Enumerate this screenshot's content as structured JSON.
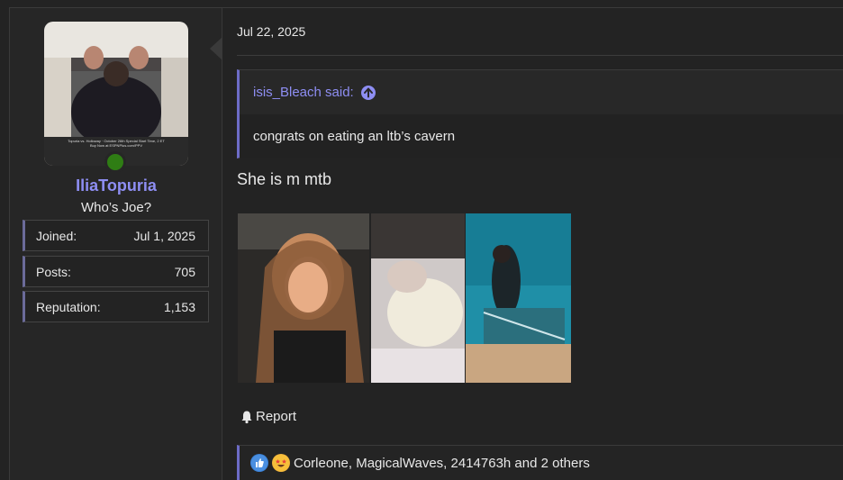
{
  "user": {
    "name": "IliaTopuria",
    "title": "Who’s Joe?",
    "avatar_caption_line1": "Topuria vs. Holloway · October 26th Special Start Time, 2 ET",
    "avatar_caption_line2": "Buy Now at ESPNPlus.com/PPV",
    "stats": [
      {
        "label": "Joined:",
        "value": "Jul 1, 2025"
      },
      {
        "label": "Posts:",
        "value": "705"
      },
      {
        "label": "Reputation:",
        "value": "1,153"
      }
    ],
    "online_color": "#2f7d14"
  },
  "post": {
    "date": "Jul 22, 2025",
    "quote_author": "isis_Bleach said:",
    "quote_text": "congrats on eating an ltb’s cavern",
    "message": "She is m mtb",
    "report_label": "Report",
    "reactions_text": "Corleone, MagicalWaves, 2414763h and 2 others",
    "reaction_icons": [
      "thumbs-up-icon",
      "star-struck-icon"
    ]
  },
  "colors": {
    "accent": "#8e8ef3",
    "quote_border": "#6d6cc7",
    "background": "#232323"
  }
}
